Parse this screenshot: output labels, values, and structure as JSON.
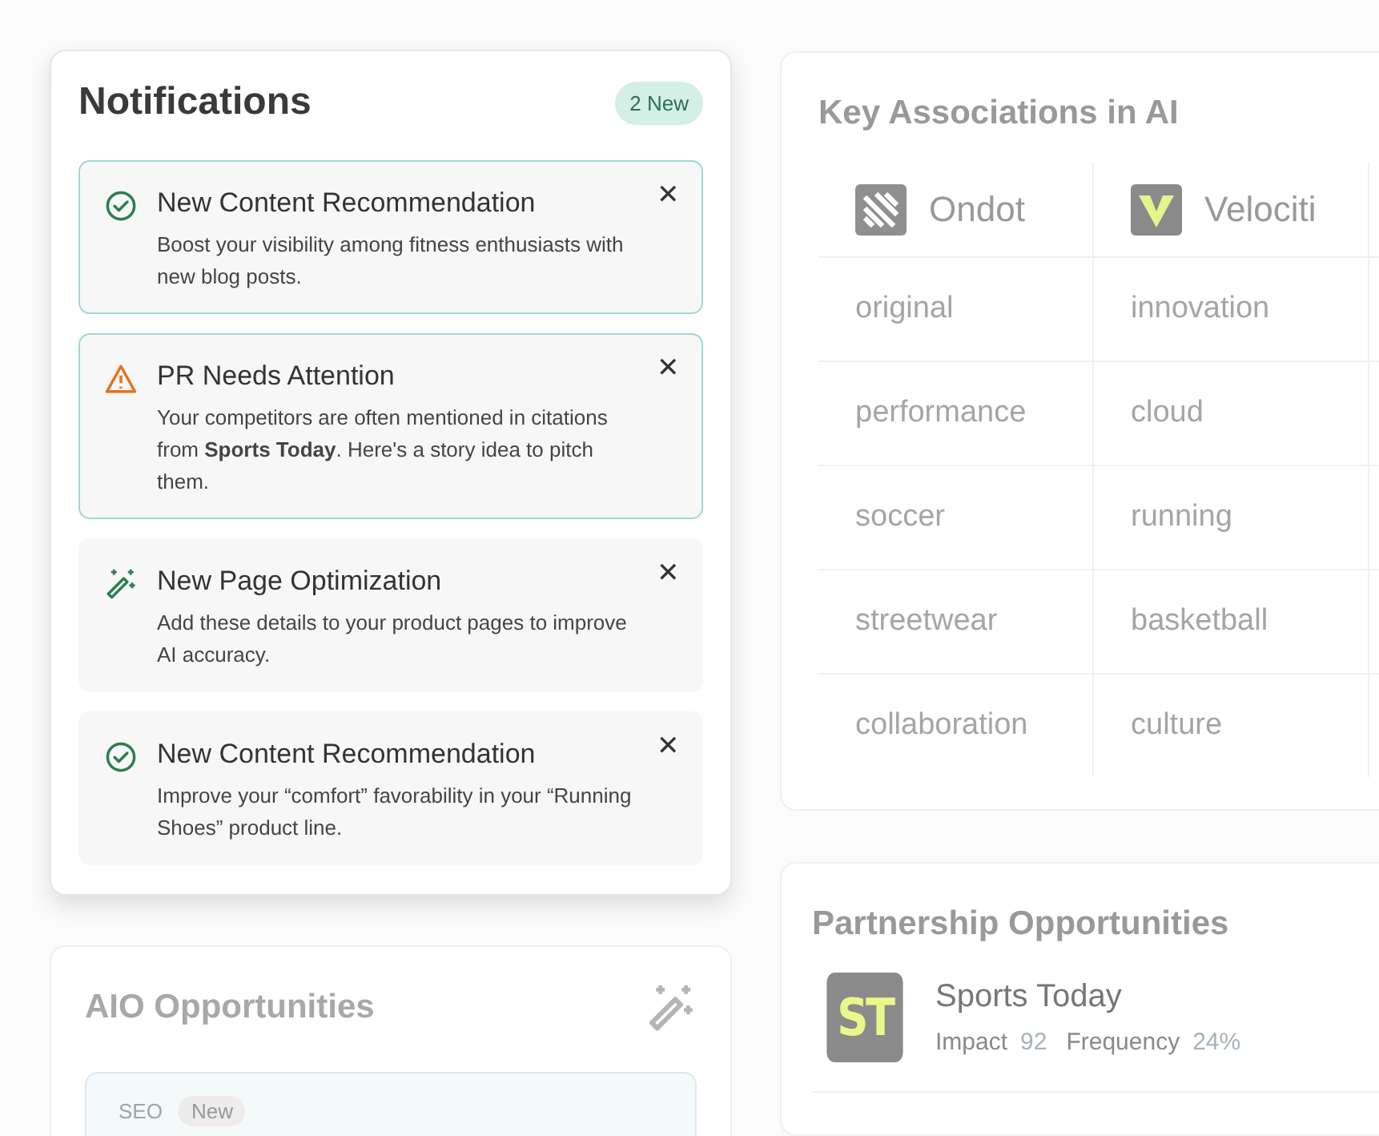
{
  "notifications": {
    "title": "Notifications",
    "badge": "2 New",
    "items": [
      {
        "kind": "success",
        "highlighted": true,
        "title": "New Content Recommendation",
        "body": "Boost your visibility among fitness enthusiasts with new blog posts.",
        "close": "✕"
      },
      {
        "kind": "warning",
        "highlighted": true,
        "title": "PR Needs Attention",
        "body": "Your competitors are often mentioned in citations from **Sports Today**. Here's a story idea to pitch them.",
        "close": "✕"
      },
      {
        "kind": "optimize",
        "highlighted": false,
        "title": "New Page Optimization",
        "body": "Add these details to your product pages to improve AI accuracy.",
        "close": "✕"
      },
      {
        "kind": "success",
        "highlighted": false,
        "title": "New Content Recommendation",
        "body": "Improve your “comfort” favorability in your “Running Shoes” product line.",
        "close": "✕"
      }
    ]
  },
  "aio_opportunities": {
    "title": "AIO Opportunities",
    "items": [
      {
        "tag": "SEO",
        "badge": "New"
      }
    ]
  },
  "key_associations": {
    "title": "Key Associations in AI",
    "columns": [
      {
        "name": "Ondot",
        "kind": "stripes",
        "terms": [
          "original",
          "performance",
          "soccer",
          "streetwear",
          "collaboration"
        ]
      },
      {
        "name": "Velociti",
        "kind": "v-mark",
        "terms": [
          "innovation",
          "cloud",
          "running",
          "basketball",
          "culture"
        ]
      }
    ]
  },
  "partnership_opportunities": {
    "title": "Partnership Opportunities",
    "items": [
      {
        "logo_text": "ST",
        "name": "Sports Today",
        "metrics": [
          {
            "label": "Impact",
            "value": "92"
          },
          {
            "label": "Frequency",
            "value": "24%"
          }
        ]
      }
    ]
  }
}
